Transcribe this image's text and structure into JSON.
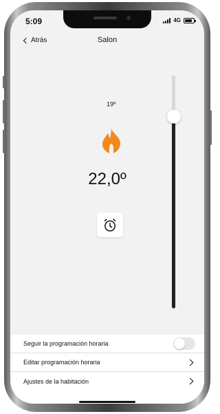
{
  "status": {
    "time": "5:09",
    "network": "4G"
  },
  "nav": {
    "back_label": "Atrás",
    "title": "Salon"
  },
  "thermostat": {
    "setpoint_label": "19º",
    "current_temperature": "22,0º",
    "flame_color": "#F08A1E",
    "slider_level": 0.15
  },
  "settings": {
    "items": [
      {
        "label": "Seguir la programación horaria",
        "control": "toggle",
        "on": false
      },
      {
        "label": "Editar programación horaria",
        "control": "chevron"
      },
      {
        "label": "Ajustes de la habitación",
        "control": "chevron"
      }
    ]
  }
}
